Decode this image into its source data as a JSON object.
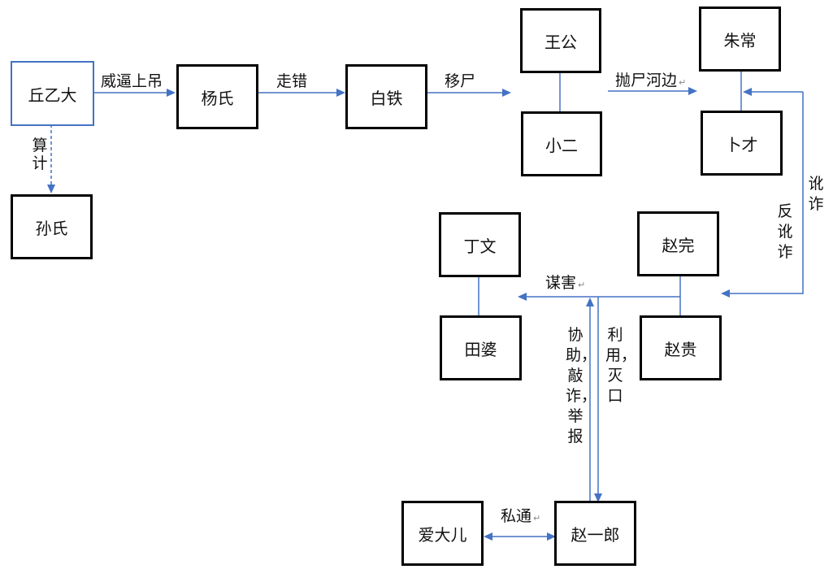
{
  "diagram": {
    "accent_color": "#4472C4",
    "nodes": {
      "qiu_yi_da": "丘乙大",
      "sun_shi": "孙氏",
      "yang_shi": "杨氏",
      "bai_tie": "白铁",
      "wang_gong": "王公",
      "xiao_er": "小二",
      "zhu_chang": "朱常",
      "bu_cai": "卜才",
      "ding_wen": "丁文",
      "tian_po": "田婆",
      "zhao_wan": "赵完",
      "zhao_gui": "赵贵",
      "ai_da_er": "爱大儿",
      "zhao_yi_lang": "赵一郎"
    },
    "edges": {
      "qiu_to_yang": "威逼上吊",
      "qiu_to_sun": "算计",
      "yang_to_bai": "走错",
      "bai_to_wang": "移尸",
      "wang_to_zhu": "抛尸河边",
      "zhao_to_zhu": "讹诈",
      "zhu_to_zhao": "反讹诈",
      "zhao_to_ding": "谋害",
      "zhaoyl_to_murder": "协助，敲诈，举报",
      "murder_to_zhaoyl": "利用，灭口",
      "ai_zhaoyl": "私通"
    },
    "return_mark": "↵"
  }
}
